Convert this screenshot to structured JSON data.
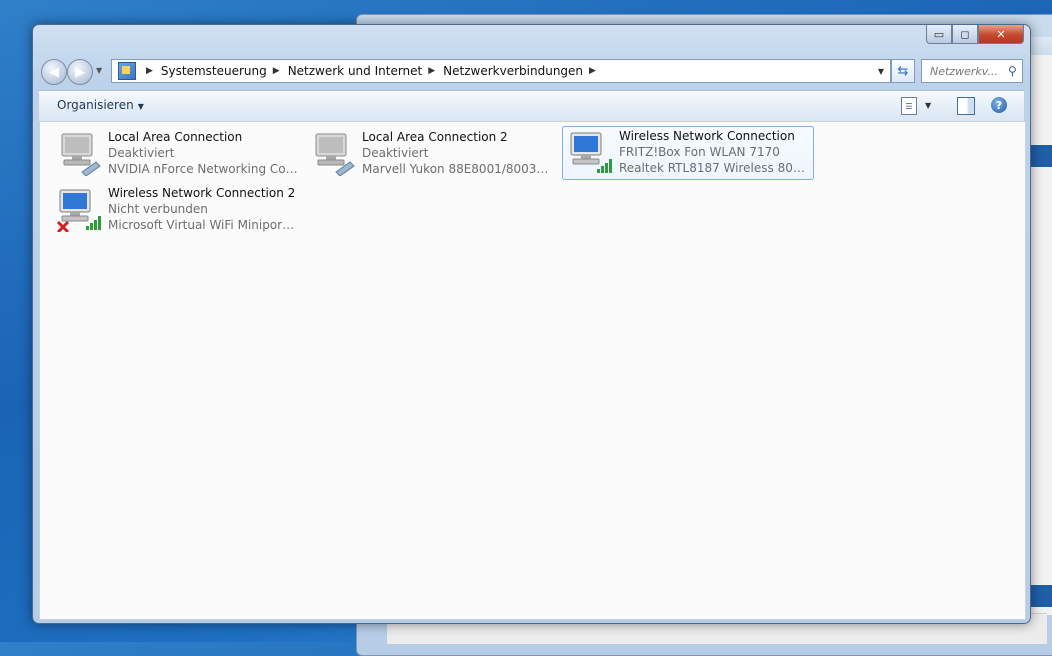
{
  "breadcrumbs": [
    "Systemsteuerung",
    "Netzwerk und Internet",
    "Netzwerkverbindungen"
  ],
  "search": {
    "placeholder": "Netzwerkv..."
  },
  "toolbar": {
    "organize_label": "Organisieren"
  },
  "window_controls": {
    "minimize": "▭",
    "maximize": "◻",
    "close": "✕"
  },
  "connections": [
    {
      "name": "Local Area Connection",
      "status": "Deaktiviert",
      "device": "NVIDIA nForce Networking Contr...",
      "type": "wired",
      "disabled": true
    },
    {
      "name": "Local Area Connection 2",
      "status": "Deaktiviert",
      "device": "Marvell Yukon 88E8001/8003/801...",
      "type": "wired",
      "disabled": true
    },
    {
      "name": "Wireless Network Connection",
      "status": "FRITZ!Box Fon WLAN 7170",
      "device": "Realtek RTL8187 Wireless 802.11b...",
      "type": "wireless",
      "selected": true
    },
    {
      "name": "Wireless Network Connection 2",
      "status": "Nicht verbunden",
      "device": "Microsoft Virtual WiFi Miniport A...",
      "type": "wireless",
      "error": true
    }
  ]
}
